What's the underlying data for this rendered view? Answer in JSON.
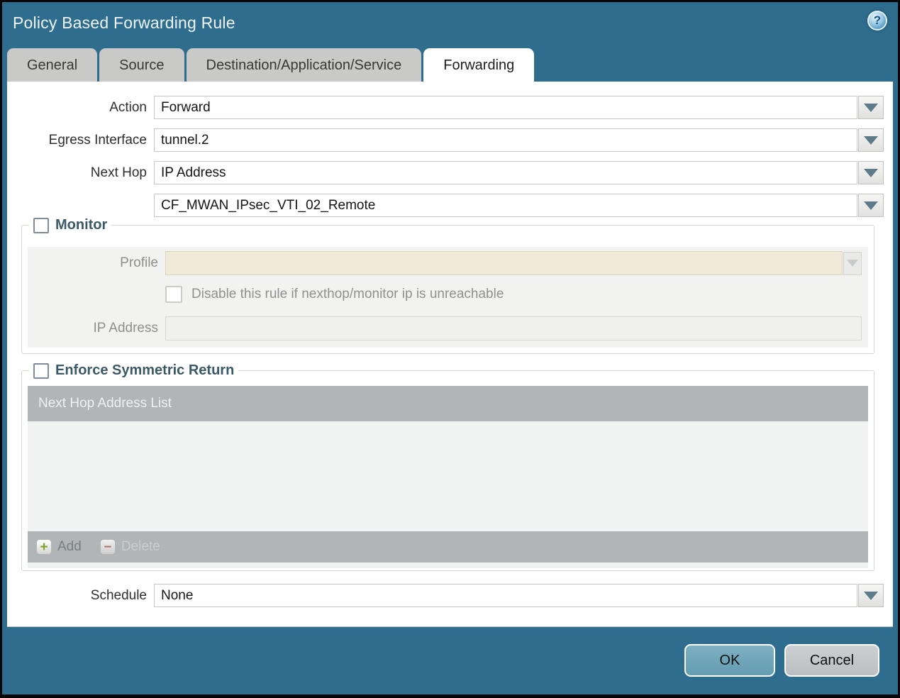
{
  "window": {
    "title": "Policy Based Forwarding Rule"
  },
  "icons": {
    "help": "?",
    "plus": "+",
    "minus": "−"
  },
  "tabs": [
    {
      "label": "General",
      "active": false
    },
    {
      "label": "Source",
      "active": false
    },
    {
      "label": "Destination/Application/Service",
      "active": false
    },
    {
      "label": "Forwarding",
      "active": true
    }
  ],
  "form": {
    "action": {
      "label": "Action",
      "value": "Forward"
    },
    "egress_interface": {
      "label": "Egress Interface",
      "value": "tunnel.2"
    },
    "next_hop": {
      "label": "Next Hop",
      "value": "IP Address"
    },
    "next_hop_address": {
      "value": "CF_MWAN_IPsec_VTI_02_Remote"
    },
    "schedule": {
      "label": "Schedule",
      "value": "None"
    }
  },
  "monitor": {
    "title": "Monitor",
    "checked": false,
    "profile": {
      "label": "Profile",
      "value": ""
    },
    "disable_rule": {
      "label": "Disable this rule if nexthop/monitor ip is unreachable",
      "checked": false
    },
    "ip_address": {
      "label": "IP Address",
      "value": ""
    }
  },
  "symmetric_return": {
    "title": "Enforce Symmetric Return",
    "checked": false,
    "table": {
      "header": "Next Hop Address List",
      "rows": []
    },
    "add_label": "Add",
    "delete_label": "Delete"
  },
  "actions": {
    "ok": "OK",
    "cancel": "Cancel"
  },
  "colors": {
    "window_teal": "#2e6d8d",
    "active_tab": "#ffffff",
    "inactive_tab": "#c9c9c7",
    "disabled_field_beige": "#efe9d8",
    "panel_gray": "#f2f2f1",
    "table_bar_gray": "#b1b5b8",
    "legend_text": "#3c5968",
    "ok_button": "#6fa8bc",
    "cancel_button": "#c4c7c9",
    "add_plus_green": "#7fa32d",
    "delete_minus_red": "#aa6a5e"
  }
}
